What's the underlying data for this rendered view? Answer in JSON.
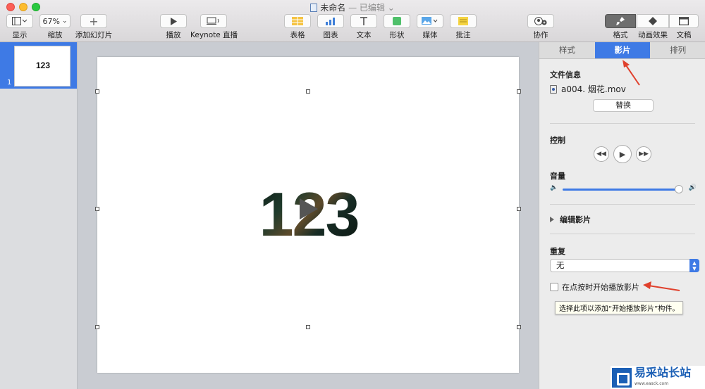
{
  "window": {
    "title": "未命名",
    "status": "— 已编辑"
  },
  "toolbar": {
    "view": {
      "label": "显示"
    },
    "zoom": {
      "label": "缩放",
      "value": "67%"
    },
    "add_slide": {
      "label": "添加幻灯片"
    },
    "play": {
      "label": "播放"
    },
    "keynote_live": {
      "label": "Keynote 直播"
    },
    "table": {
      "label": "表格"
    },
    "chart": {
      "label": "图表"
    },
    "text": {
      "label": "文本"
    },
    "shape": {
      "label": "形状"
    },
    "media": {
      "label": "媒体"
    },
    "comment": {
      "label": "批注"
    },
    "collaborate": {
      "label": "协作"
    },
    "format": {
      "label": "格式"
    },
    "animate": {
      "label": "动画效果"
    },
    "document": {
      "label": "文稿"
    }
  },
  "navigator": {
    "slides": [
      {
        "number": "1",
        "thumb_text": "123"
      }
    ]
  },
  "slide": {
    "text": "123"
  },
  "inspector": {
    "tabs": [
      "样式",
      "影片",
      "排列"
    ],
    "active_tab": "影片",
    "file_info": {
      "title": "文件信息",
      "filename": "a004. 烟花.mov",
      "replace_label": "替换"
    },
    "controls": {
      "title": "控制"
    },
    "volume": {
      "title": "音量",
      "level": 0.98
    },
    "edit_movie": {
      "label": "编辑影片"
    },
    "repeat": {
      "title": "重复",
      "value": "无"
    },
    "start_on_click": {
      "label": "在点按时开始播放影片",
      "checked": false,
      "tooltip": "选择此项以添加“开始播放影片”构件。"
    }
  },
  "colors": {
    "accent": "#3e7ae5",
    "annotation_arrow": "#e0402c"
  }
}
